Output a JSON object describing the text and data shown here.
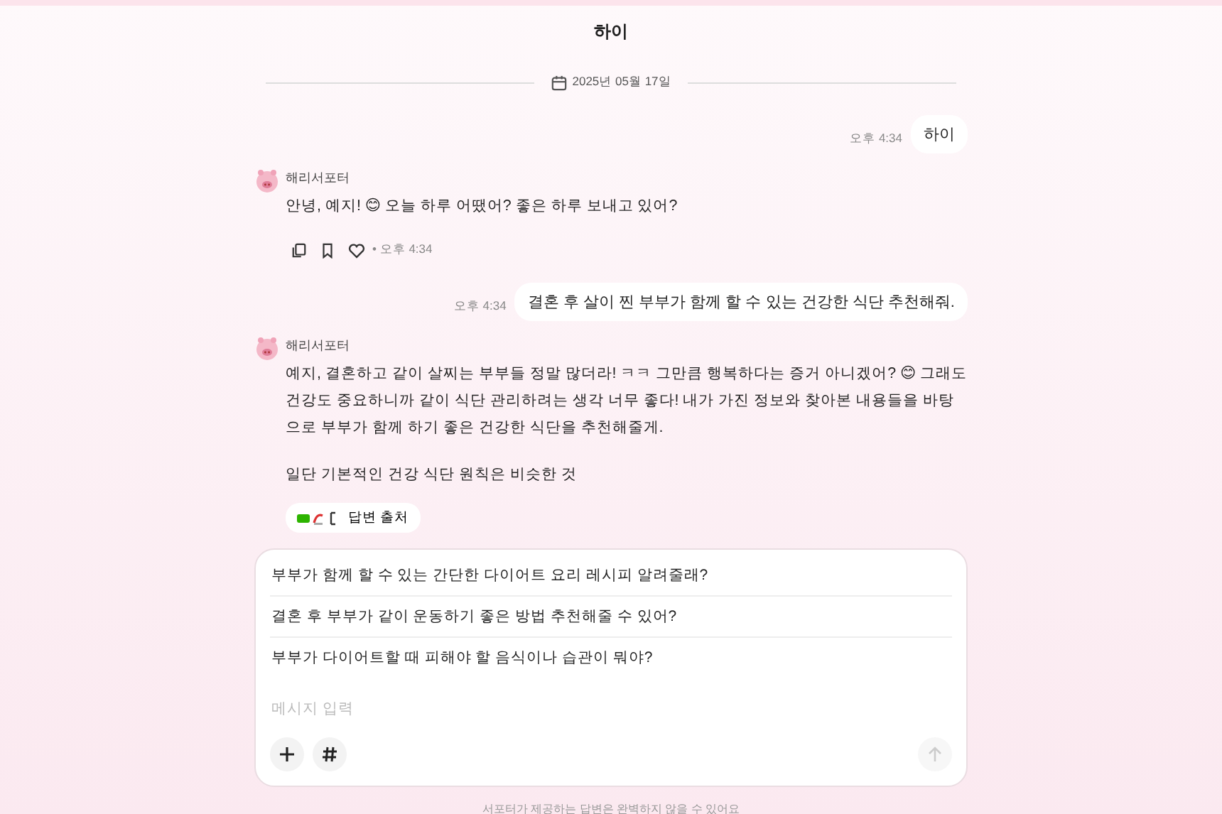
{
  "header": {
    "title": "하이"
  },
  "date_divider": {
    "label": "2025년 05월 17일"
  },
  "messages": [
    {
      "kind": "user",
      "text": "하이",
      "time": "오후 4:34"
    },
    {
      "kind": "bot",
      "sender": "해리서포터",
      "paragraphs": [
        "안녕, 예지! 😊 오늘 하루 어땠어? 좋은 하루 보내고 있어?"
      ],
      "time": "• 오후 4:34"
    },
    {
      "kind": "user",
      "text": "결혼 후 살이 찐 부부가 함께 할 수 있는 건강한 식단 추천해줘.",
      "time": "오후 4:34"
    },
    {
      "kind": "bot",
      "sender": "해리서포터",
      "paragraphs": [
        "예지, 결혼하고 같이 살찌는 부부들 정말 많더라! ㅋㅋ 그만큼 행복하다는 증거 아니겠어? 😊 그래도 건강도 중요하니까 같이 식단 관리하려는 생각 너무 좋다! 내가 가진 정보와 찾아본 내용들을 바탕으로 부부가 함께 하기 좋은 건강한 식단을 추천해줄게.",
        "일단 기본적인 건강 식단 원칙은 비슷한 것"
      ],
      "sources": {
        "label": "답변 출처"
      }
    }
  ],
  "suggestions": [
    "부부가 함께 할 수 있는 간단한 다이어트 요리 레시피 알려줄래?",
    "결혼 후 부부가 같이 운동하기 좋은 방법 추천해줄 수 있어?",
    "부부가 다이어트할 때 피해야 할 음식이나 습관이 뭐야?"
  ],
  "composer": {
    "placeholder": "메시지 입력"
  },
  "disclaimer": "서포터가 제공하는 답변은 완벽하지 않을 수 있어요"
}
